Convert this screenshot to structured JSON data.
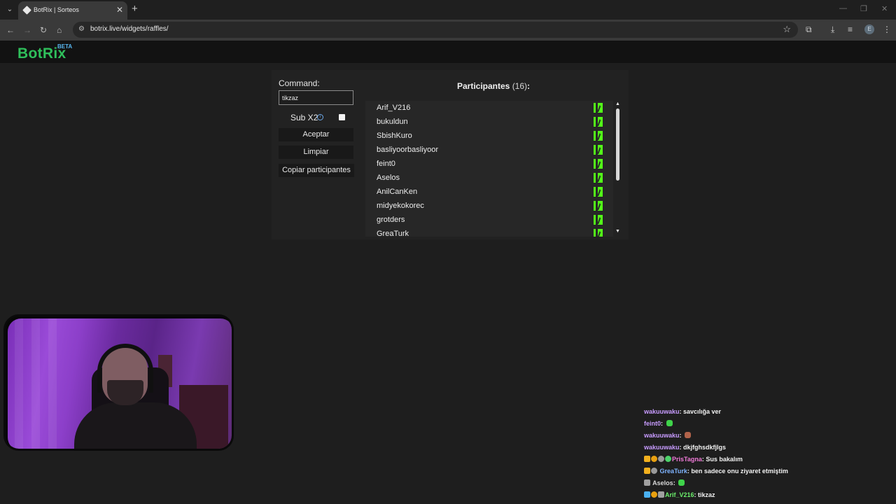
{
  "browser": {
    "tab_title": "BotRix | Sorteos",
    "url": "botrix.live/widgets/raffles/",
    "profile_initial": "E"
  },
  "site": {
    "logo": "BotRix",
    "logo_badge": "BETA"
  },
  "raffle": {
    "command_label": "Command:",
    "command_value": "tikzaz",
    "sub_label": "Sub X2",
    "sub_checked": false,
    "accept_label": "Aceptar",
    "clear_label": "Limpiar",
    "copy_label": "Copiar participantes",
    "participants_title": "Participantes",
    "participants_count": "(16)",
    "participants_suffix": ":",
    "participants": [
      "Arif_V216",
      "bukuldun",
      "SbishKuro",
      "basliyoorbasliyoor",
      "feint0",
      "Aselos",
      "AnilCanKen",
      "midyekokorec",
      "grotders",
      "GreaTurk"
    ]
  },
  "chat": {
    "messages": [
      {
        "user": "wakuuwaku",
        "color": "#c89cff",
        "text": "savcılığa ver"
      },
      {
        "user": "feint0",
        "color": "#c89cff",
        "text": "",
        "emote": "green"
      },
      {
        "user": "wakuuwaku",
        "color": "#c89cff",
        "text": "",
        "emote": "brown"
      },
      {
        "user": "wakuuwaku",
        "color": "#c89cff",
        "text": "dkjfghsdkfjlgs"
      },
      {
        "user": "PrisTagna",
        "color": "#f07ad8",
        "text": "Sus bakalım"
      },
      {
        "user": "GreaTurk",
        "color": "#7fb4ff",
        "text": "ben sadece onu ziyaret etmiştim"
      },
      {
        "user": "Aselos",
        "color": "#d8d8d8",
        "text": "",
        "emote": "green"
      },
      {
        "user": "Arif_V216",
        "color": "#6cf06c",
        "text": "tikzaz"
      }
    ]
  },
  "colors": {
    "accent_green": "#2fbf5b",
    "kick_green": "#53fc18",
    "beta_blue": "#58b7f0"
  }
}
